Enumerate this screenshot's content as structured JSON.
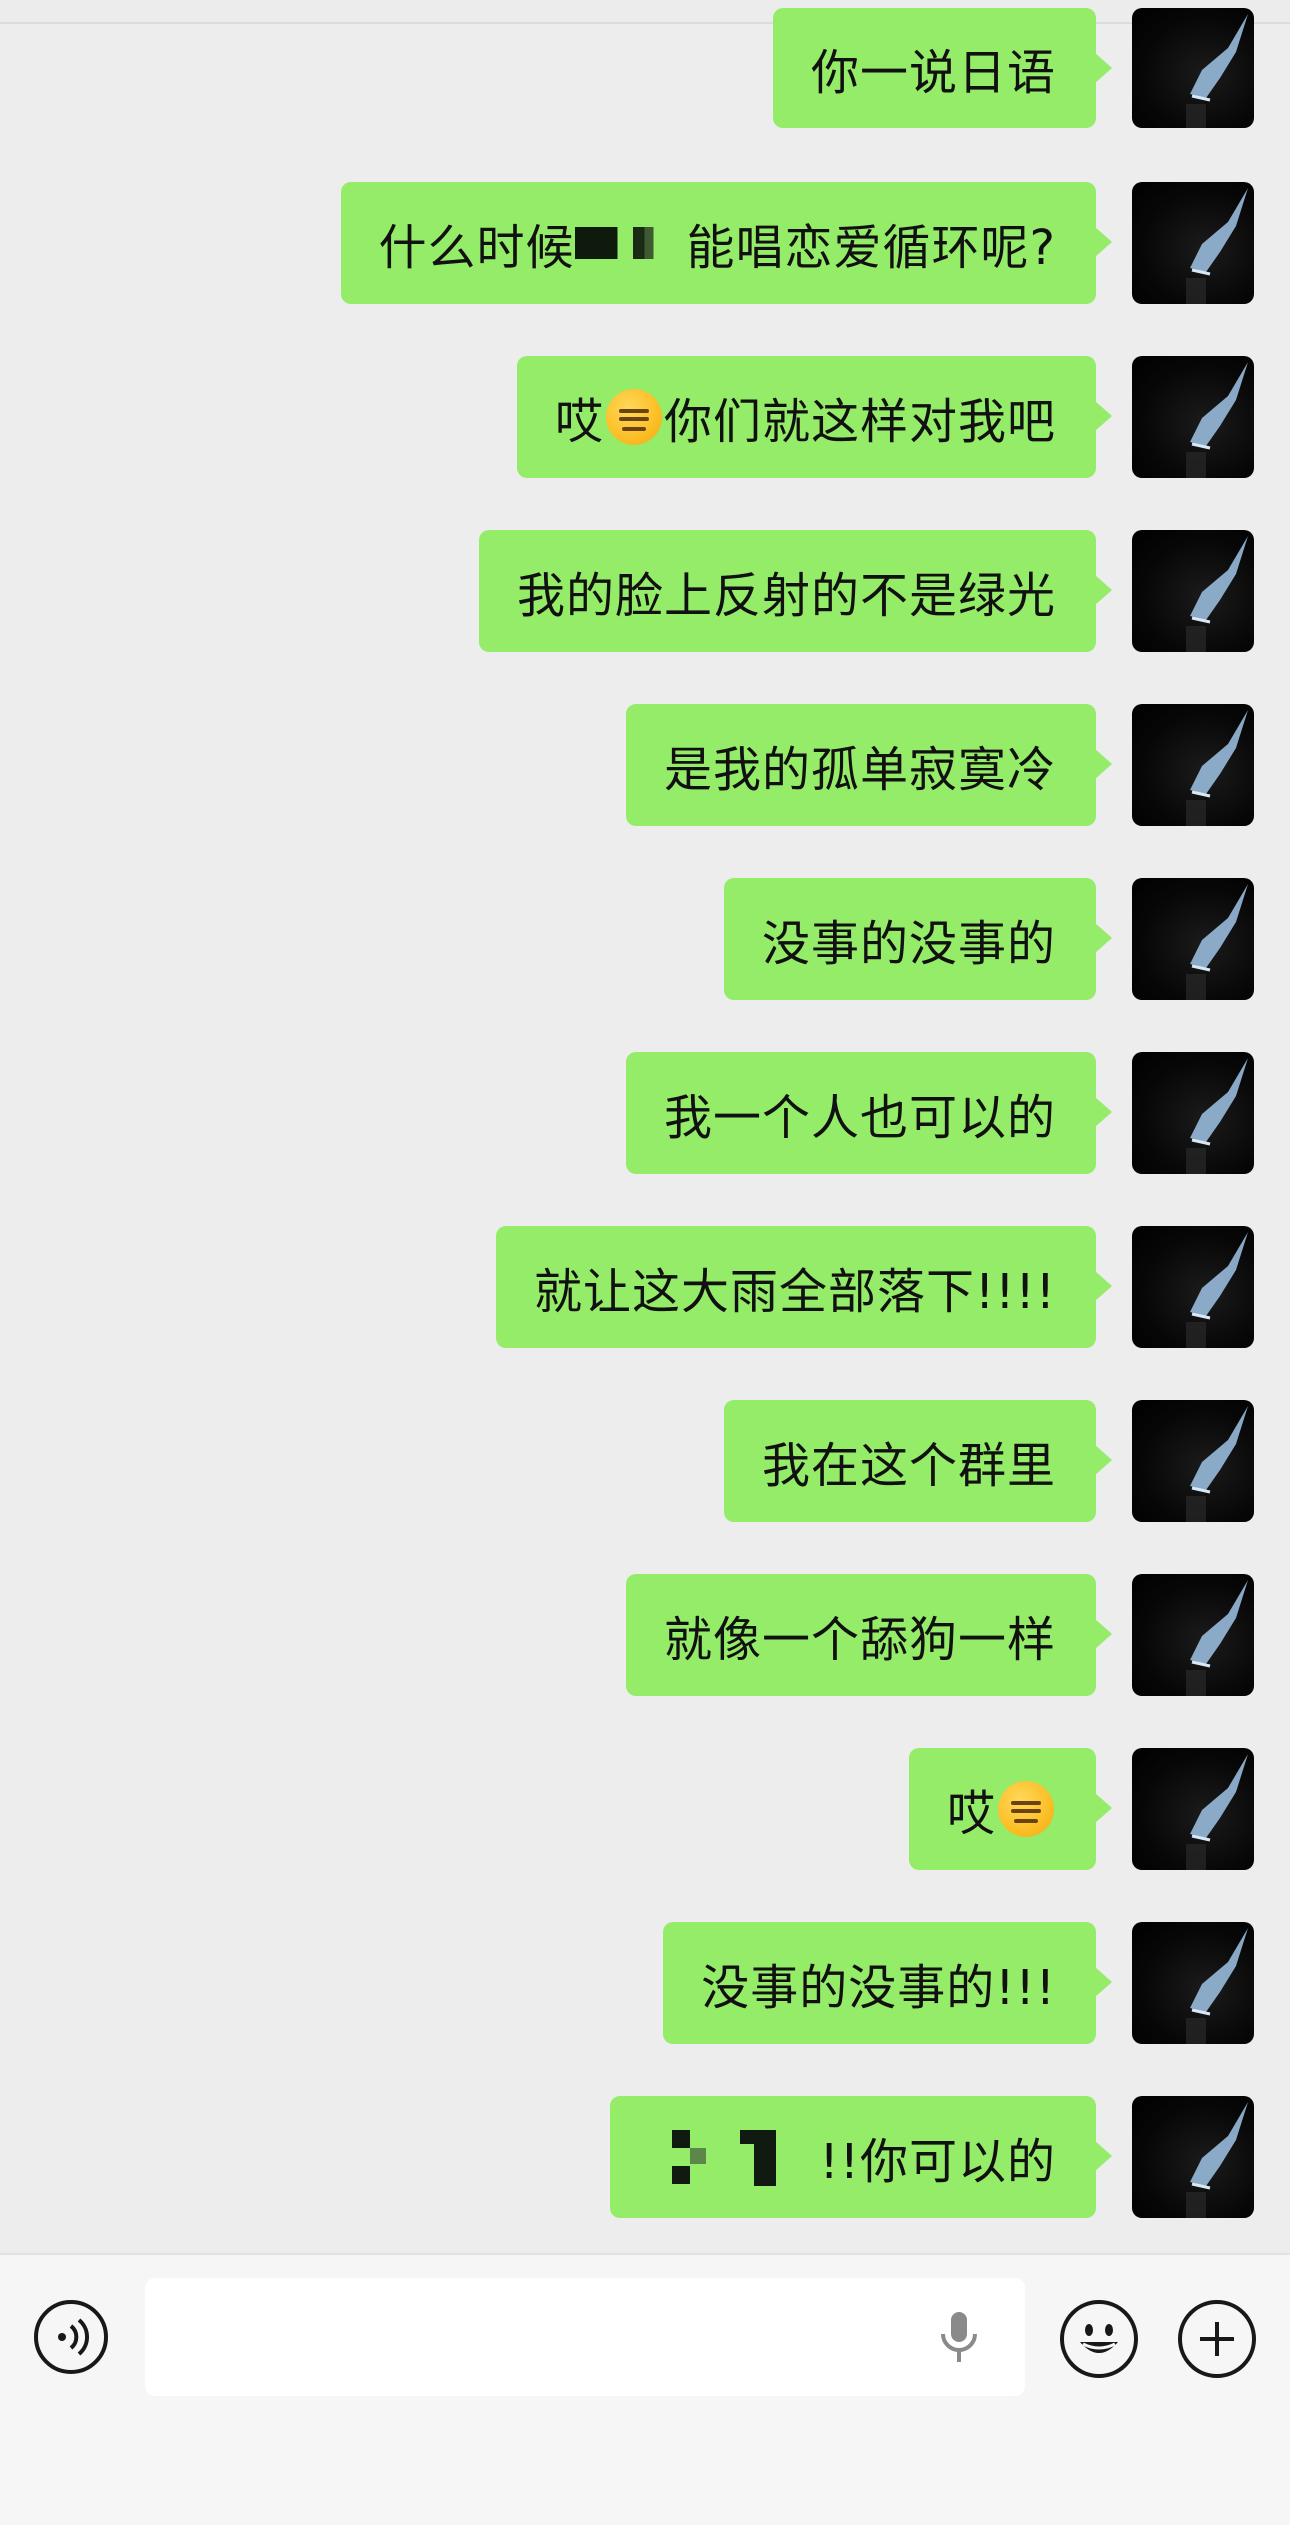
{
  "chat": {
    "messages": [
      {
        "text": "你一说日语"
      },
      {
        "text_before": "什么时候",
        "text_after": "能唱恋爱循环呢?"
      },
      {
        "text_before": "哎",
        "emoji": "expressionless-face",
        "text_after": "你们就这样对我吧"
      },
      {
        "text": "我的脸上反射的不是绿光"
      },
      {
        "text": "是我的孤单寂寞冷"
      },
      {
        "text": "没事的没事的"
      },
      {
        "text": "我一个人也可以的"
      },
      {
        "text": "就让这大雨全部落下!!!!"
      },
      {
        "text": "我在这个群里"
      },
      {
        "text": "就像一个舔狗一样"
      },
      {
        "text_before": "哎",
        "emoji": "expressionless-face"
      },
      {
        "text": "没事的没事的!!!"
      },
      {
        "text_after": "!!你可以的"
      }
    ]
  },
  "input_bar": {
    "voice_icon": "voice-wave-icon",
    "mic_icon": "microphone-icon",
    "emoji_icon": "smiley-face-icon",
    "plus_icon": "plus-circle-icon",
    "text_value": ""
  },
  "colors": {
    "background": "#ededed",
    "bubble": "#95ec69",
    "input_bar": "#f6f6f6"
  }
}
